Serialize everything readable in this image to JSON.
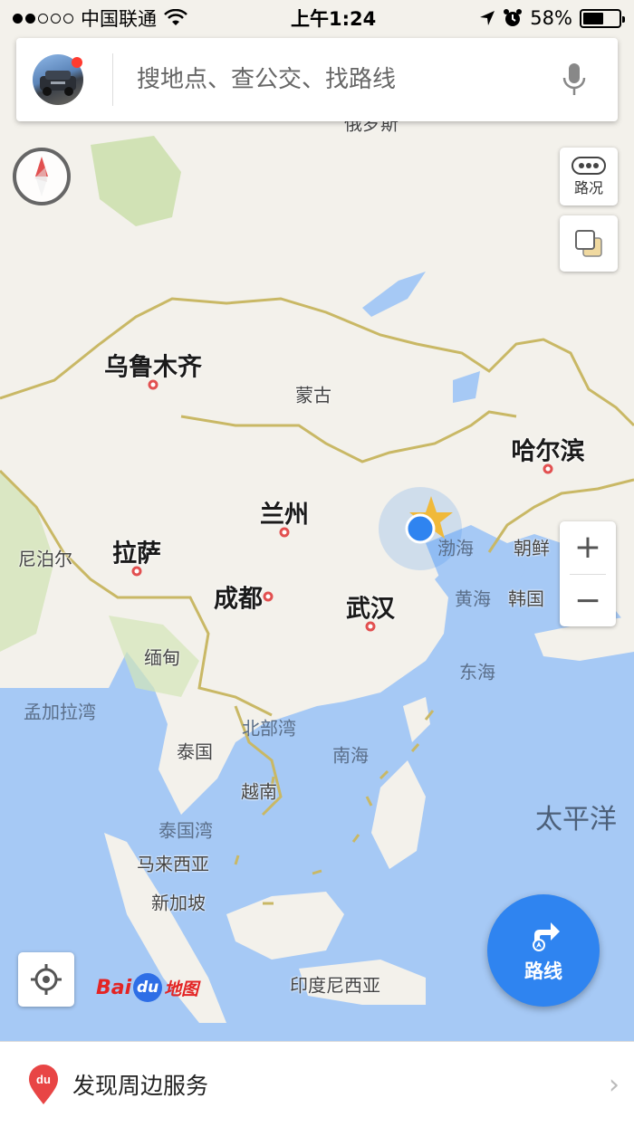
{
  "status_bar": {
    "carrier": "中国联通",
    "time": "上午1:24",
    "battery": "58%",
    "battery_level": 0.58
  },
  "search": {
    "placeholder": "搜地点、查公交、找路线"
  },
  "controls": {
    "traffic_label": "路况",
    "zoom_in": "+",
    "zoom_out": "−",
    "route_label": "路线"
  },
  "map": {
    "partial_top_label": "俄罗斯",
    "cities": [
      "乌鲁木齐",
      "哈尔滨",
      "兰州",
      "拉萨",
      "成都",
      "武汉"
    ],
    "regions": [
      "蒙古",
      "尼泊尔",
      "缅甸",
      "泰国",
      "越南",
      "马来西亚",
      "新加坡",
      "印度尼西亚",
      "朝鲜",
      "韩国"
    ],
    "seas": [
      "渤海",
      "黄海",
      "东海",
      "南海",
      "北部湾",
      "泰国湾",
      "孟加拉湾"
    ],
    "ocean": "太平洋"
  },
  "brand": {
    "bai": "Bai",
    "du": "du",
    "map": "地图"
  },
  "bottom": {
    "label": "发现周边服务",
    "chevron": "›"
  },
  "colors": {
    "land": "#f3f1eb",
    "water": "#a6c9f5",
    "border": "#c9b865",
    "accent": "#2f84f0",
    "city_marker": "#e25050"
  }
}
